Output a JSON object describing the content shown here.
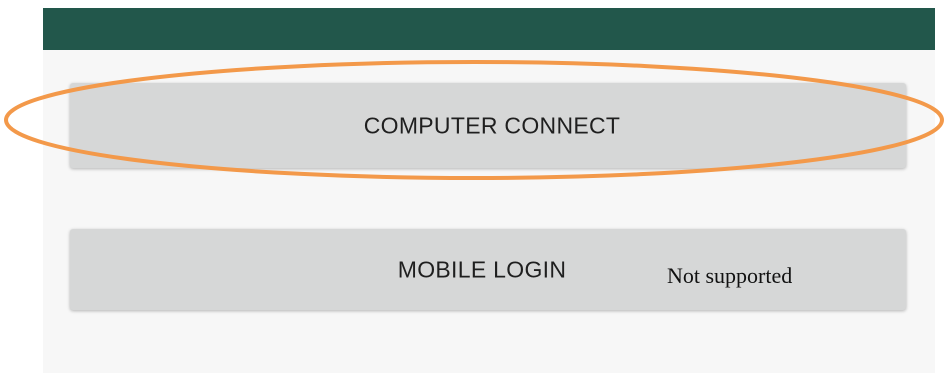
{
  "screen": {
    "colors": {
      "app_bar": "#22574b",
      "background": "#f7f7f7",
      "button": "#d6d7d7",
      "highlight": "#f3994a"
    }
  },
  "buttons": {
    "computer_connect": {
      "label": "COMPUTER CONNECT"
    },
    "mobile_login": {
      "label": "MOBILE LOGIN"
    }
  },
  "annotations": {
    "mobile_note": "Not supported",
    "highlight_target": "computer_connect"
  }
}
